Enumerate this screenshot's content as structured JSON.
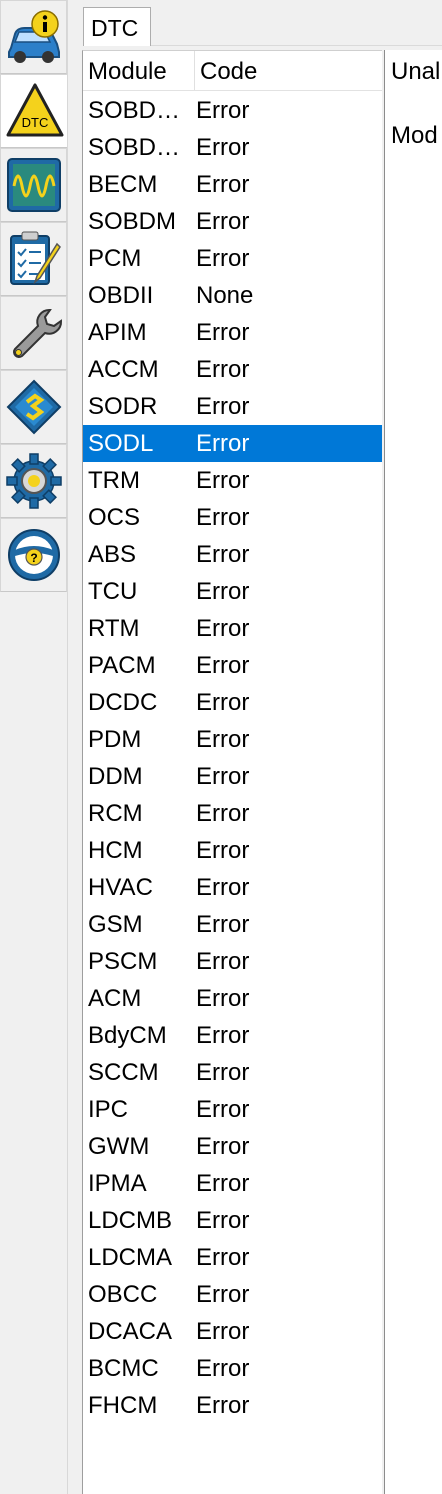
{
  "sidebar": {
    "items": [
      {
        "icon": "car-info-icon",
        "active": false
      },
      {
        "icon": "dtc-warning-icon",
        "label": "DTC",
        "active": true
      },
      {
        "icon": "oscilloscope-icon",
        "active": false
      },
      {
        "icon": "checklist-icon",
        "active": false
      },
      {
        "icon": "wrench-icon",
        "active": false
      },
      {
        "icon": "chip-icon",
        "active": false
      },
      {
        "icon": "gear-icon",
        "active": false
      },
      {
        "icon": "steering-help-icon",
        "active": false
      }
    ]
  },
  "tab": {
    "label": "DTC"
  },
  "table": {
    "headers": {
      "module": "Module",
      "code": "Code"
    },
    "selected_index": 9,
    "rows": [
      {
        "module": "SOBDMC",
        "code": "Error"
      },
      {
        "module": "SOBDMB",
        "code": "Error"
      },
      {
        "module": "BECM",
        "code": "Error"
      },
      {
        "module": "SOBDM",
        "code": "Error"
      },
      {
        "module": "PCM",
        "code": "Error"
      },
      {
        "module": "OBDII",
        "code": "None"
      },
      {
        "module": "APIM",
        "code": "Error"
      },
      {
        "module": "ACCM",
        "code": "Error"
      },
      {
        "module": "SODR",
        "code": "Error"
      },
      {
        "module": "SODL",
        "code": "Error"
      },
      {
        "module": "TRM",
        "code": "Error"
      },
      {
        "module": "OCS",
        "code": "Error"
      },
      {
        "module": "ABS",
        "code": "Error"
      },
      {
        "module": "TCU",
        "code": "Error"
      },
      {
        "module": "RTM",
        "code": "Error"
      },
      {
        "module": "PACM",
        "code": "Error"
      },
      {
        "module": "DCDC",
        "code": "Error"
      },
      {
        "module": "PDM",
        "code": "Error"
      },
      {
        "module": "DDM",
        "code": "Error"
      },
      {
        "module": "RCM",
        "code": "Error"
      },
      {
        "module": "HCM",
        "code": "Error"
      },
      {
        "module": "HVAC",
        "code": "Error"
      },
      {
        "module": "GSM",
        "code": "Error"
      },
      {
        "module": "PSCM",
        "code": "Error"
      },
      {
        "module": "ACM",
        "code": "Error"
      },
      {
        "module": "BdyCM",
        "code": "Error"
      },
      {
        "module": "SCCM",
        "code": "Error"
      },
      {
        "module": "IPC",
        "code": "Error"
      },
      {
        "module": "GWM",
        "code": "Error"
      },
      {
        "module": "IPMA",
        "code": "Error"
      },
      {
        "module": "LDCMB",
        "code": "Error"
      },
      {
        "module": "LDCMA",
        "code": "Error"
      },
      {
        "module": "OBCC",
        "code": "Error"
      },
      {
        "module": "DCACA",
        "code": "Error"
      },
      {
        "module": "BCMC",
        "code": "Error"
      },
      {
        "module": "FHCM",
        "code": "Error"
      }
    ]
  },
  "detail": {
    "line1": "Unal",
    "line2": "Mod"
  },
  "colors": {
    "selection": "#0078d7",
    "dtc_yellow": "#f4d21c",
    "icon_blue": "#1f6aa5"
  }
}
